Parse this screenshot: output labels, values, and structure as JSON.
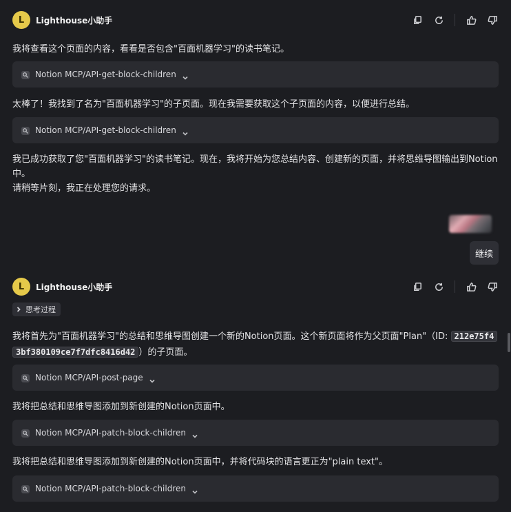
{
  "bot": {
    "avatar_letter": "L",
    "name": "Lighthouse小助手",
    "avatar_color": "#e5c94a"
  },
  "message1": {
    "text1": "我将查看这个页面的内容，看看是否包含\"百面机器学习\"的读书笔记。",
    "tool1": "Notion MCP/API-get-block-children",
    "text2": "太棒了！我找到了名为\"百面机器学习\"的子页面。现在我需要获取这个子页面的内容，以便进行总结。",
    "tool2": "Notion MCP/API-get-block-children",
    "text3a": "我已成功获取了您\"百面机器学习\"的读书笔记。现在，我将开始为您总结内容、创建新的页面，并将思维导图输出到Notion",
    "text3b": "中。",
    "text3c": "请稍等片刻，我正在处理您的请求。"
  },
  "user_message": {
    "text": "继续"
  },
  "message2": {
    "thinking_label": "思考过程",
    "text1_pre": "我将首先为\"百面机器学习\"的总结和思维导图创建一个新的Notion页面。这个新页面将作为父页面\"Plan\"（ID: ",
    "code_line1": "212e75f4",
    "code_line2": "3bf380109ce7f7dfc8416d42",
    "text1_post": "）的子页面。",
    "tool1": "Notion MCP/API-post-page",
    "text2": "我将把总结和思维导图添加到新创建的Notion页面中。",
    "tool2": "Notion MCP/API-patch-block-children",
    "text3": "我将把总结和思维导图添加到新创建的Notion页面中，并将代码块的语言更正为\"plain text\"。",
    "tool3": "Notion MCP/API-patch-block-children"
  },
  "icons": {
    "copy": "copy-icon",
    "regenerate": "refresh-icon",
    "like": "thumbs-up-icon",
    "dislike": "thumbs-down-icon",
    "tool": "tool-icon",
    "chevron": "chevron-down-icon"
  },
  "colors": {
    "background": "#1c1d21",
    "tool_card": "#2a2b30",
    "user_bubble": "#2e2f35"
  }
}
